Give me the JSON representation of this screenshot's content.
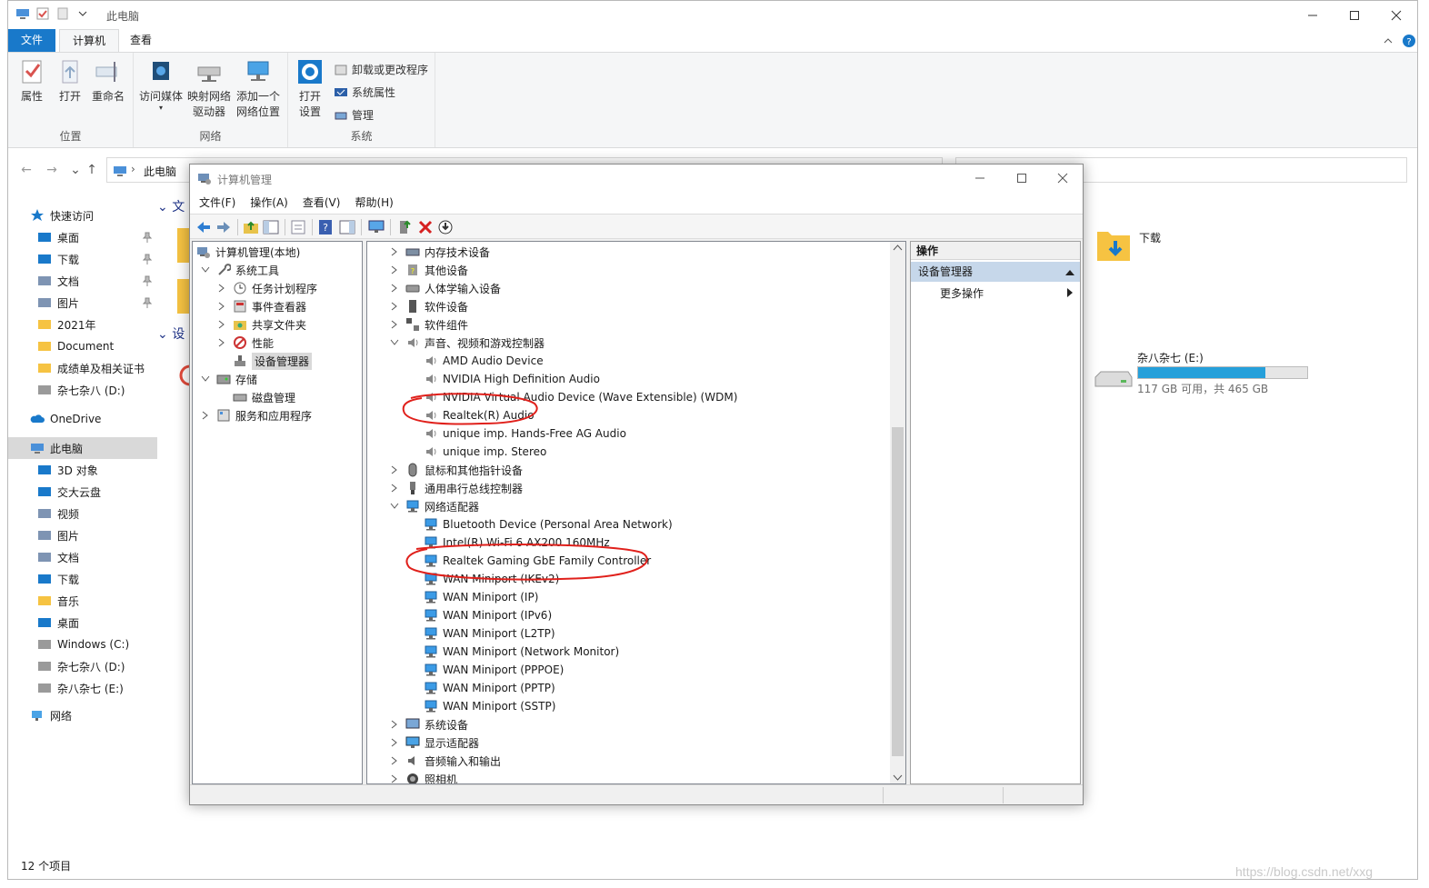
{
  "explorer": {
    "title": "此电脑",
    "tabs": [
      "文件",
      "计算机",
      "查看"
    ],
    "ribbon": {
      "location_group": "位置",
      "network_group": "网络",
      "system_group": "系统",
      "properties": "属性",
      "open": "打开",
      "rename": "重命名",
      "access_media": "访问媒体",
      "map_drive_1": "映射网络",
      "map_drive_2": "驱动器",
      "add_location_1": "添加一个",
      "add_location_2": "网络位置",
      "open_settings_1": "打开",
      "open_settings_2": "设置",
      "uninstall": "卸载或更改程序",
      "system_props": "系统属性",
      "manage": "管理"
    },
    "breadcrumb": "此电脑",
    "nav": {
      "quick_access": "快速访问",
      "quick_items": [
        "桌面",
        "下载",
        "文档",
        "图片",
        "2021年",
        "Document",
        "成绩单及相关证书",
        "杂七杂八 (D:)"
      ],
      "onedrive": "OneDrive",
      "this_pc": "此电脑",
      "pc_items": [
        "3D 对象",
        "交大云盘",
        "视频",
        "图片",
        "文档",
        "下载",
        "音乐",
        "桌面",
        "Windows (C:)",
        "杂七杂八 (D:)",
        "杂八杂七 (E:)"
      ],
      "network": "网络"
    },
    "main": {
      "folders_header_partial": "文",
      "devices_header_partial": "设",
      "download_folder": "下载",
      "drive_e_name": "杂八杂七 (E:)",
      "drive_e_space": "117 GB 可用，共 465 GB",
      "drive_e_used_fraction": 0.75
    },
    "status": "12 个项目"
  },
  "cm": {
    "title": "计算机管理",
    "menu": [
      "文件(F)",
      "操作(A)",
      "查看(V)",
      "帮助(H)"
    ],
    "left_tree": [
      {
        "label": "计算机管理(本地)",
        "level": 0,
        "exp": "",
        "icon": "computer-mgmt-icon"
      },
      {
        "label": "系统工具",
        "level": 1,
        "exp": "down",
        "icon": "tools-icon"
      },
      {
        "label": "任务计划程序",
        "level": 2,
        "exp": "right",
        "icon": "clock-icon"
      },
      {
        "label": "事件查看器",
        "level": 2,
        "exp": "right",
        "icon": "event-viewer-icon"
      },
      {
        "label": "共享文件夹",
        "level": 2,
        "exp": "right",
        "icon": "shared-folder-icon"
      },
      {
        "label": "性能",
        "level": 2,
        "exp": "right",
        "icon": "performance-icon"
      },
      {
        "label": "设备管理器",
        "level": 2,
        "exp": "",
        "icon": "device-manager-icon",
        "selected": true
      },
      {
        "label": "存储",
        "level": 1,
        "exp": "down",
        "icon": "storage-icon"
      },
      {
        "label": "磁盘管理",
        "level": 2,
        "exp": "",
        "icon": "disk-icon"
      },
      {
        "label": "服务和应用程序",
        "level": 1,
        "exp": "right",
        "icon": "services-icon"
      }
    ],
    "device_tree": [
      {
        "label": "内存技术设备",
        "level": 0,
        "exp": "right",
        "icon": "memory-icon"
      },
      {
        "label": "其他设备",
        "level": 0,
        "exp": "right",
        "icon": "other-device-icon"
      },
      {
        "label": "人体学输入设备",
        "level": 0,
        "exp": "right",
        "icon": "hid-icon"
      },
      {
        "label": "软件设备",
        "level": 0,
        "exp": "right",
        "icon": "software-device-icon"
      },
      {
        "label": "软件组件",
        "level": 0,
        "exp": "right",
        "icon": "software-component-icon"
      },
      {
        "label": "声音、视频和游戏控制器",
        "level": 0,
        "exp": "down",
        "icon": "speaker-icon"
      },
      {
        "label": "AMD Audio Device",
        "level": 1,
        "exp": "",
        "icon": "speaker-icon"
      },
      {
        "label": "NVIDIA High Definition Audio",
        "level": 1,
        "exp": "",
        "icon": "speaker-icon"
      },
      {
        "label": "NVIDIA Virtual Audio Device (Wave Extensible) (WDM)",
        "level": 1,
        "exp": "",
        "icon": "speaker-icon"
      },
      {
        "label": "Realtek(R) Audio",
        "level": 1,
        "exp": "",
        "icon": "speaker-icon"
      },
      {
        "label": "unique imp. Hands-Free AG Audio",
        "level": 1,
        "exp": "",
        "icon": "speaker-icon"
      },
      {
        "label": "unique imp. Stereo",
        "level": 1,
        "exp": "",
        "icon": "speaker-icon"
      },
      {
        "label": "鼠标和其他指针设备",
        "level": 0,
        "exp": "right",
        "icon": "mouse-icon"
      },
      {
        "label": "通用串行总线控制器",
        "level": 0,
        "exp": "right",
        "icon": "usb-icon"
      },
      {
        "label": "网络适配器",
        "level": 0,
        "exp": "down",
        "icon": "network-adapter-icon"
      },
      {
        "label": "Bluetooth Device (Personal Area Network)",
        "level": 1,
        "exp": "",
        "icon": "network-adapter-icon"
      },
      {
        "label": "Intel(R) Wi-Fi 6 AX200 160MHz",
        "level": 1,
        "exp": "",
        "icon": "network-adapter-icon"
      },
      {
        "label": "Realtek Gaming GbE Family Controller",
        "level": 1,
        "exp": "",
        "icon": "network-adapter-icon"
      },
      {
        "label": "WAN Miniport (IKEv2)",
        "level": 1,
        "exp": "",
        "icon": "network-adapter-icon"
      },
      {
        "label": "WAN Miniport (IP)",
        "level": 1,
        "exp": "",
        "icon": "network-adapter-icon"
      },
      {
        "label": "WAN Miniport (IPv6)",
        "level": 1,
        "exp": "",
        "icon": "network-adapter-icon"
      },
      {
        "label": "WAN Miniport (L2TP)",
        "level": 1,
        "exp": "",
        "icon": "network-adapter-icon"
      },
      {
        "label": "WAN Miniport (Network Monitor)",
        "level": 1,
        "exp": "",
        "icon": "network-adapter-icon"
      },
      {
        "label": "WAN Miniport (PPPOE)",
        "level": 1,
        "exp": "",
        "icon": "network-adapter-icon"
      },
      {
        "label": "WAN Miniport (PPTP)",
        "level": 1,
        "exp": "",
        "icon": "network-adapter-icon"
      },
      {
        "label": "WAN Miniport (SSTP)",
        "level": 1,
        "exp": "",
        "icon": "network-adapter-icon"
      },
      {
        "label": "系统设备",
        "level": 0,
        "exp": "right",
        "icon": "system-device-icon"
      },
      {
        "label": "显示适配器",
        "level": 0,
        "exp": "right",
        "icon": "display-adapter-icon"
      },
      {
        "label": "音频输入和输出",
        "level": 0,
        "exp": "right",
        "icon": "audio-io-icon"
      },
      {
        "label": "照相机",
        "level": 0,
        "exp": "right",
        "icon": "camera-icon"
      }
    ],
    "actions": {
      "header": "操作",
      "section": "设备管理器",
      "more": "更多操作"
    }
  },
  "watermark": "https://blog.csdn.net/xxg"
}
